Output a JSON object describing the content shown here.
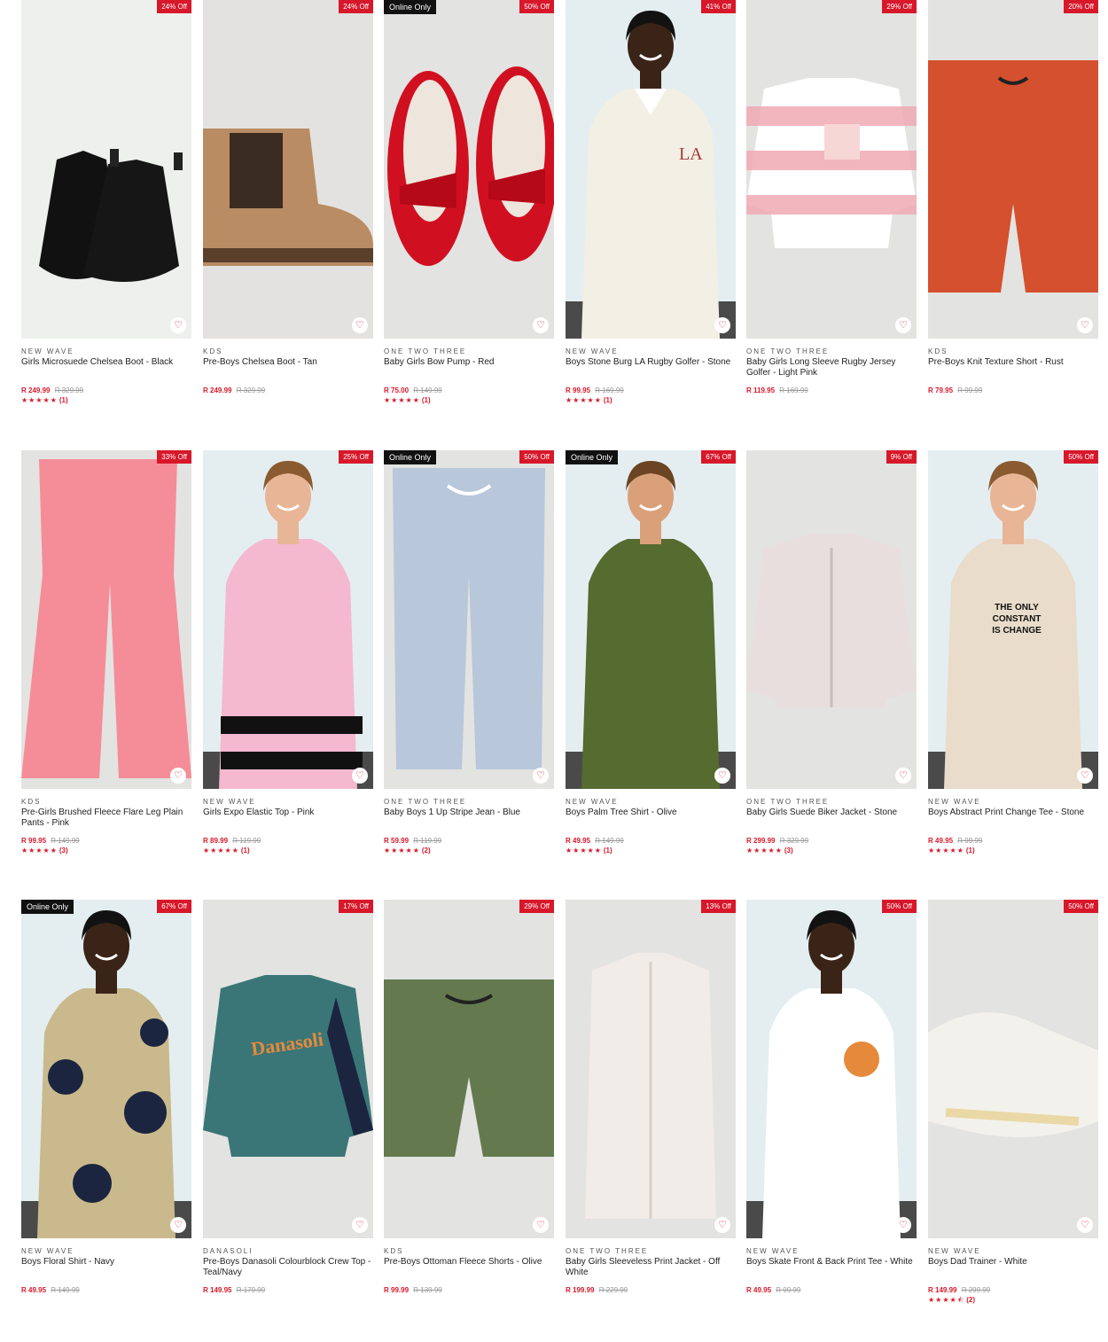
{
  "colors": {
    "accent": "#d7182a",
    "online_badge": "#111111",
    "image_bg": "#e3e3e1"
  },
  "products": [
    {
      "badge": "24% Off",
      "online": "",
      "brand": "NEW WAVE",
      "name": "Girls Microsuede Chelsea Boot - Black",
      "price": "R 249.99",
      "was": "R 329.99",
      "stars": "★★★★★",
      "count": "(1)",
      "art": "boot-black",
      "bg": "#eef0ee"
    },
    {
      "badge": "24% Off",
      "online": "",
      "brand": "KDS",
      "name": "Pre-Boys Chelsea Boot - Tan",
      "price": "R 249.99",
      "was": "R 329.99",
      "stars": "",
      "count": "",
      "art": "boot-tan",
      "bg": "#e3e2e0"
    },
    {
      "badge": "50% Off",
      "online": "Online Only",
      "brand": "ONE TWO THREE",
      "name": "Baby Girls Bow Pump - Red",
      "price": "R 75.00",
      "was": "R 149.99",
      "stars": "★★★★★",
      "count": "(1)",
      "art": "pump-red",
      "bg": "#e3e3e1"
    },
    {
      "badge": "41% Off",
      "online": "",
      "brand": "NEW WAVE",
      "name": "Boys Stone Burg LA Rugby Golfer - Stone",
      "price": "R 99.95",
      "was": "R 169.99",
      "stars": "★★★★★",
      "count": "(1)",
      "art": "model-rugby",
      "bg": "#e4eef0"
    },
    {
      "badge": "29% Off",
      "online": "",
      "brand": "ONE TWO THREE",
      "name": "Baby Girls Long Sleeve Rugby Jersey Golfer - Light Pink",
      "price": "R 119.95",
      "was": "R 169.99",
      "stars": "",
      "count": "",
      "art": "jersey-pink",
      "bg": "#e3e3e1"
    },
    {
      "badge": "20% Off",
      "online": "",
      "brand": "KDS",
      "name": "Pre-Boys Knit Texture Short - Rust",
      "price": "R 79.95",
      "was": "R 99.99",
      "stars": "",
      "count": "",
      "art": "short-rust",
      "bg": "#e3e3e1"
    },
    {
      "badge": "33% Off",
      "online": "",
      "brand": "KDS",
      "name": "Pre-Girls Brushed Fleece Flare Leg Plain Pants - Pink",
      "price": "R 99.95",
      "was": "R 149.99",
      "stars": "★★★★★",
      "count": "(3)",
      "art": "pants-pink",
      "bg": "#e3e3e1"
    },
    {
      "badge": "25% Off",
      "online": "",
      "brand": "NEW WAVE",
      "name": "Girls Expo Elastic Top - Pink",
      "price": "R 89.99",
      "was": "R 119.99",
      "stars": "★★★★★",
      "count": "(1)",
      "art": "model-pink",
      "bg": "#e4eef0"
    },
    {
      "badge": "50% Off",
      "online": "Online Only",
      "brand": "ONE TWO THREE",
      "name": "Baby Boys 1 Up Stripe Jean - Blue",
      "price": "R 59.99",
      "was": "R 119.99",
      "stars": "★★★★★",
      "count": "(2)",
      "art": "jean-stripe",
      "bg": "#e3e3e1"
    },
    {
      "badge": "67% Off",
      "online": "Online Only",
      "brand": "NEW WAVE",
      "name": "Boys Palm Tree Shirt - Olive",
      "price": "R 49.95",
      "was": "R 149.99",
      "stars": "★★★★★",
      "count": "(1)",
      "art": "model-olive",
      "bg": "#e4eef0"
    },
    {
      "badge": "9% Off",
      "online": "",
      "brand": "ONE TWO THREE",
      "name": "Baby Girls Suede Biker Jacket - Stone",
      "price": "R 299.99",
      "was": "R 329.99",
      "stars": "★★★★★",
      "count": "(3)",
      "art": "jacket-stone",
      "bg": "#e3e3e1"
    },
    {
      "badge": "50% Off",
      "online": "",
      "brand": "NEW WAVE",
      "name": "Boys Abstract Print Change Tee - Stone",
      "price": "R 49.95",
      "was": "R 99.99",
      "stars": "★★★★★",
      "count": "(1)",
      "art": "model-tee",
      "bg": "#e4eef0",
      "print": [
        "THE ONLY",
        "CONSTANT",
        "IS CHANGE"
      ]
    },
    {
      "badge": "67% Off",
      "online": "Online Only",
      "brand": "NEW WAVE",
      "name": "Boys Floral Shirt - Navy",
      "price": "R 49.95",
      "was": "R 149.99",
      "stars": "",
      "count": "",
      "art": "model-floral",
      "bg": "#e4eef0"
    },
    {
      "badge": "17% Off",
      "online": "",
      "brand": "DANASOLI",
      "name": "Pre-Boys Danasoli Colourblock Crew Top - Teal/Navy",
      "price": "R 149.95",
      "was": "R 179.99",
      "stars": "",
      "count": "",
      "art": "crew-teal",
      "bg": "#e3e3e1",
      "print": [
        "Danasoli"
      ]
    },
    {
      "badge": "29% Off",
      "online": "",
      "brand": "KDS",
      "name": "Pre-Boys Ottoman Fleece Shorts - Olive",
      "price": "R 99.99",
      "was": "R 139.99",
      "stars": "",
      "count": "",
      "art": "short-olive",
      "bg": "#e3e3e1"
    },
    {
      "badge": "13% Off",
      "online": "",
      "brand": "ONE TWO THREE",
      "name": "Baby Girls Sleeveless Print Jacket - Off White",
      "price": "R 199.99",
      "was": "R 229.99",
      "stars": "",
      "count": "",
      "art": "vest-white",
      "bg": "#e3e3e1"
    },
    {
      "badge": "50% Off",
      "online": "",
      "brand": "NEW WAVE",
      "name": "Boys Skate Front & Back Print Tee - White",
      "price": "R 49.95",
      "was": "R 99.99",
      "stars": "",
      "count": "",
      "art": "model-white",
      "bg": "#e4eef0"
    },
    {
      "badge": "50% Off",
      "online": "",
      "brand": "NEW WAVE",
      "name": "Boys Dad Trainer - White",
      "price": "R 149.99",
      "was": "R 299.99",
      "stars": "★★★★⯪",
      "count": "(2)",
      "art": "trainer-white",
      "bg": "#e3e3e1"
    }
  ]
}
